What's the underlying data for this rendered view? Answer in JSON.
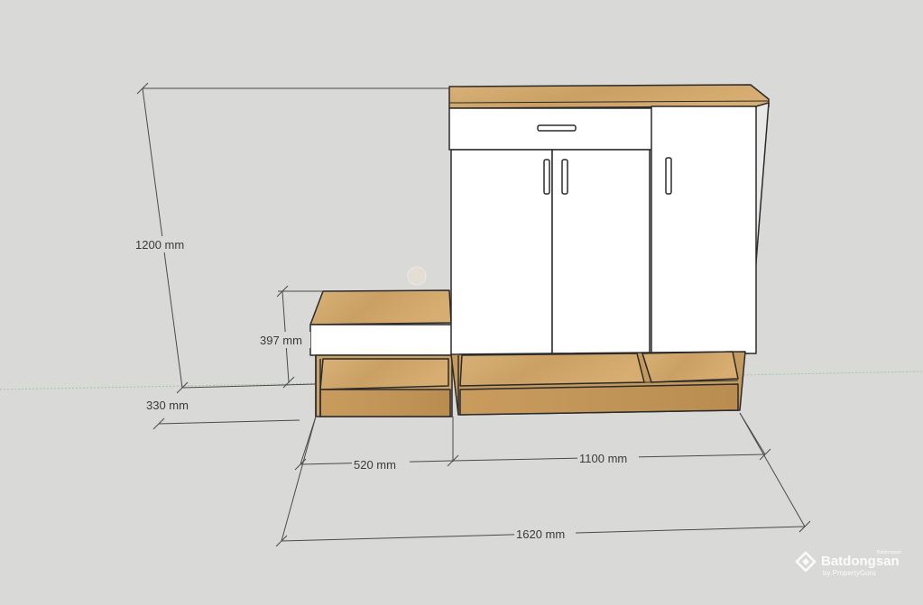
{
  "dimensions": {
    "height_total": "1200 mm",
    "bench_height": "397 mm",
    "bench_depth": "330 mm",
    "bench_width": "520 mm",
    "cabinet_width": "1100 mm",
    "total_width": "1620 mm"
  },
  "watermark": {
    "brand": "Batdongsan",
    "tagline": "by PropertyGuru",
    "trademark": "Batdongsan"
  },
  "colors": {
    "background": "#d9d9d7",
    "wood": "#d2a86a",
    "white_panel": "#ffffff",
    "outline": "#2b2b2b"
  }
}
